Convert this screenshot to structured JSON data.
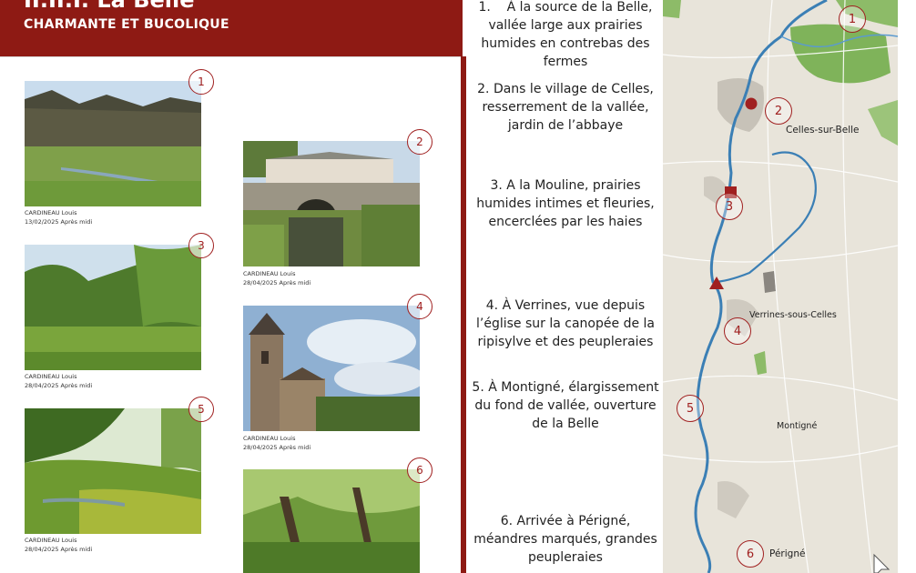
{
  "header": {
    "title": "II.II.I. La Belle",
    "subtitle": "CHARMANTE ET BUCOLIQUE"
  },
  "photos": [
    {
      "num": "1",
      "author": "CARDINEAU Louis",
      "date": "13/02/2025 Après midi"
    },
    {
      "num": "2",
      "author": "CARDINEAU Louis",
      "date": "28/04/2025 Après midi"
    },
    {
      "num": "3",
      "author": "CARDINEAU Louis",
      "date": "28/04/2025 Après midi"
    },
    {
      "num": "4",
      "author": "CARDINEAU Louis",
      "date": "28/04/2025 Après midi"
    },
    {
      "num": "5",
      "author": "CARDINEAU Louis",
      "date": "28/04/2025 Après midi"
    },
    {
      "num": "6"
    }
  ],
  "descriptions": [
    "1.    À la source de la Belle, vallée large aux prairies humides en contrebas des fermes",
    "2. Dans le village de Celles, resserrement de la vallée, jardin de l’abbaye",
    "3. A la Mouline, prairies humides intimes et fleuries, encerclées par les haies",
    "4. À Verrines, vue depuis l’église sur la canopée de la ripisylve et des peupleraies",
    "5. À Montigné, élargissement du fond de vallée, ouverture de la Belle",
    "6. Arrivée à Périgné, méandres marqués, grandes peupleraies"
  ],
  "map": {
    "labels": [
      "Celles-sur-Belle",
      "Verrines-sous-Celles",
      "Montigné",
      "Périgné"
    ],
    "numbers": [
      "1",
      "2",
      "3",
      "4",
      "5",
      "6"
    ]
  },
  "colors": {
    "accent": "#8e1a14",
    "marker": "#a02020",
    "river": "#3b7fb5"
  }
}
